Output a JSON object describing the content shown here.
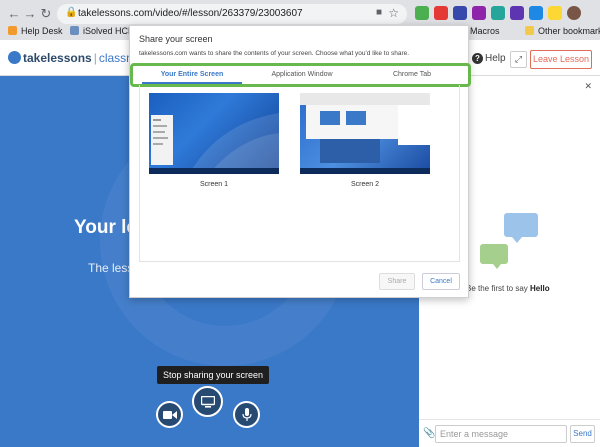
{
  "browser": {
    "url": "takelessons.com/video/#/lesson/263379/23003607",
    "bookmarks": [
      {
        "label": "Help Desk",
        "color": "#f29a2e"
      },
      {
        "label": "iSolved HCM",
        "color": "#6b8fbf"
      },
      {
        "label": "Macros",
        "color": "#9aa0a6"
      },
      {
        "label": "Other bookmarks",
        "color": "#f2c94c"
      }
    ],
    "extension_colors": [
      "#4caf50",
      "#e53935",
      "#3949ab",
      "#8e24aa",
      "#26a69a",
      "#5e35b1",
      "#1e88e5",
      "#fdd835",
      "#795548"
    ]
  },
  "header": {
    "logo_take": "takelessons",
    "logo_sep": "|",
    "logo_classroom": "classroom",
    "help_label": "Help",
    "leave_label": "Leave Lesson"
  },
  "video": {
    "heading": "Your le",
    "subtext": "The less",
    "stop_sharing": "Stop sharing your screen"
  },
  "chat": {
    "empty_prefix": "Be the first to say ",
    "empty_bold": "Hello",
    "input_placeholder": "Enter a message",
    "send_label": "Send"
  },
  "share_dialog": {
    "title": "Share your screen",
    "description": "takelessons.com wants to share the contents of your screen. Choose what you'd like to share.",
    "tabs": [
      {
        "label": "Your Entire Screen",
        "active": true
      },
      {
        "label": "Application Window",
        "active": false
      },
      {
        "label": "Chrome Tab",
        "active": false
      }
    ],
    "screens": [
      {
        "label": "Screen 1"
      },
      {
        "label": "Screen 2"
      }
    ],
    "share_label": "Share",
    "cancel_label": "Cancel",
    "highlight_color": "#69b84d"
  },
  "colors": {
    "brand_blue": "#3a78c8",
    "leave_red": "#e06c5a"
  }
}
